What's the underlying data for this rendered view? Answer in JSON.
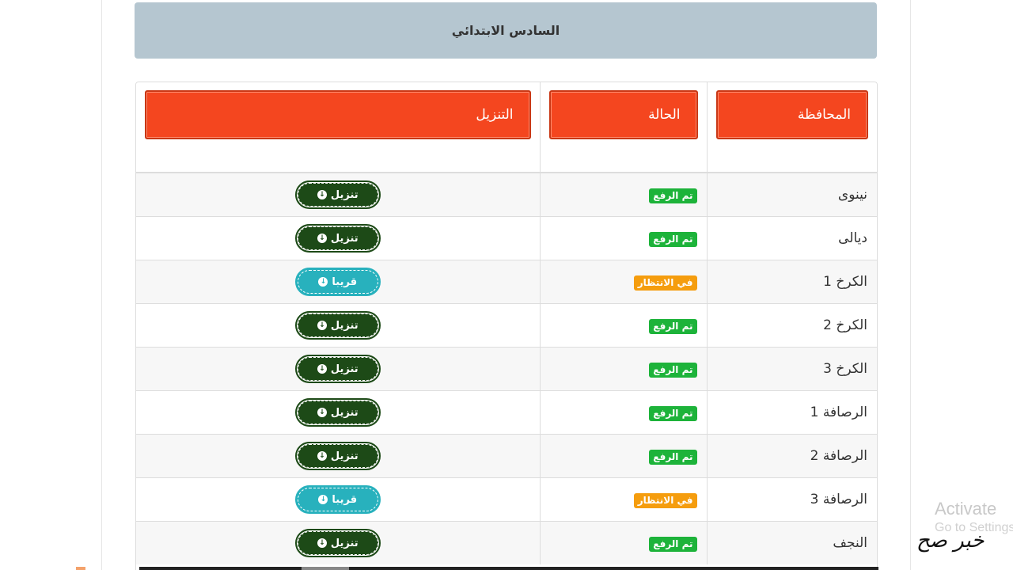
{
  "header": {
    "grade_title": "السادس الابتدائي"
  },
  "table": {
    "columns": {
      "governorate": "المحافظة",
      "status": "الحالة",
      "download": "التنزيل"
    },
    "rows": [
      {
        "governorate": "نينوى",
        "status": "تم الرفع",
        "status_type": "uploaded",
        "action": "تنزيل",
        "action_type": "download"
      },
      {
        "governorate": "ديالى",
        "status": "تم الرفع",
        "status_type": "uploaded",
        "action": "تنزيل",
        "action_type": "download"
      },
      {
        "governorate": "الكرخ 1",
        "status": "في الانتظار",
        "status_type": "waiting",
        "action": "قريبا",
        "action_type": "soon"
      },
      {
        "governorate": "الكرخ 2",
        "status": "تم الرفع",
        "status_type": "uploaded",
        "action": "تنزيل",
        "action_type": "download"
      },
      {
        "governorate": "الكرخ 3",
        "status": "تم الرفع",
        "status_type": "uploaded",
        "action": "تنزيل",
        "action_type": "download"
      },
      {
        "governorate": "الرصافة 1",
        "status": "تم الرفع",
        "status_type": "uploaded",
        "action": "تنزيل",
        "action_type": "download"
      },
      {
        "governorate": "الرصافة 2",
        "status": "تم الرفع",
        "status_type": "uploaded",
        "action": "تنزيل",
        "action_type": "download"
      },
      {
        "governorate": "الرصافة 3",
        "status": "في الانتظار",
        "status_type": "waiting",
        "action": "قريبا",
        "action_type": "soon"
      },
      {
        "governorate": "النجف",
        "status": "تم الرفع",
        "status_type": "uploaded",
        "action": "تنزيل",
        "action_type": "download"
      }
    ]
  },
  "colors": {
    "header_bg": "#b5c6d0",
    "column_header_bg": "#f4461f",
    "uploaded_badge": "#1db33a",
    "waiting_badge": "#f59d0e",
    "download_button": "#1d4a17",
    "soon_button": "#28b1bd"
  },
  "icons": {
    "download": "circle-arrow-down-icon"
  },
  "overlay": {
    "activate_line1": "Activate",
    "activate_line2": "Go to Settings",
    "logo": "خبر صح"
  }
}
